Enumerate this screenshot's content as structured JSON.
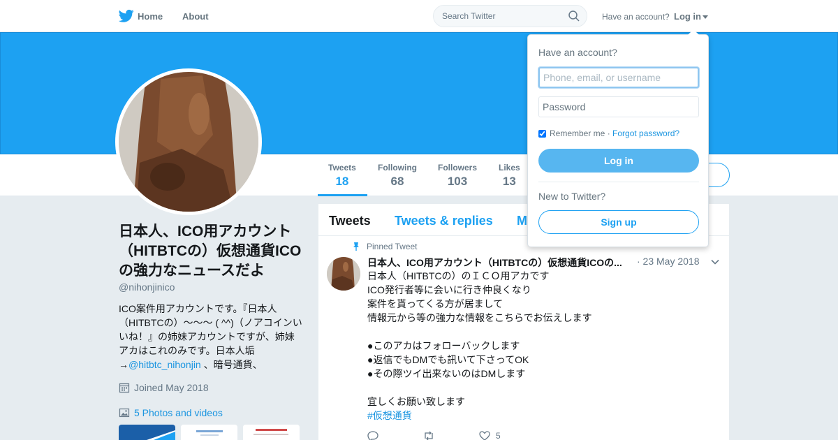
{
  "nav": {
    "home_label": "Home",
    "about_label": "About",
    "search_placeholder": "Search Twitter",
    "have_account": "Have an account?",
    "login_label": "Log in"
  },
  "profile": {
    "display_name": "日本人、ICO用アカウント（HITBTCの）仮想通貨ICOの強力なニュースだよ",
    "screen_name": "@nihonjinico",
    "bio": {
      "text": "ICO案件用アカウントです。『日本人（HITBTCの）～～～ ( ^^)（ノアコインいいね！』の姉妹アカウントですが、姉妹アカはこれのみです。日本人垢→",
      "link": "@hitbtc_nihonjin",
      "suffix": " 、暗号通貨、"
    },
    "joined": "Joined May 2018",
    "photos_link": "5 Photos and videos"
  },
  "stats": [
    {
      "label": "Tweets",
      "value": "18"
    },
    {
      "label": "Following",
      "value": "68"
    },
    {
      "label": "Followers",
      "value": "103"
    },
    {
      "label": "Likes",
      "value": "13"
    }
  ],
  "timeline": {
    "tabs": [
      "Tweets",
      "Tweets & replies",
      "M"
    ],
    "pinned_label": "Pinned Tweet",
    "tweet": {
      "fullname": "日本人、ICO用アカウント（HITBTCの）仮想通貨ICOの...",
      "date": "· 23 May 2018",
      "lines": [
        "日本人（HITBTCの）のＩＣＯ用アカです",
        "ICO発行者等に会いに行き仲良くなり",
        "案件を貰ってくる方が居まして",
        "情報元から等の強力な情報をこちらでお伝えします",
        "",
        "●このアカはフォローバックします",
        "●返信でもDMでも訊いて下さってOK",
        "●その際ツイ出来ないのはDMします",
        "",
        "宜しくお願い致します"
      ],
      "hashtag": "#仮想通貨",
      "like_count": "5"
    }
  },
  "login_dropdown": {
    "title": "Have an account?",
    "username_placeholder": "Phone, email, or username",
    "password_placeholder": "Password",
    "remember_label": "Remember me",
    "separator": " · ",
    "forgot_label": "Forgot password?",
    "login_button": "Log in",
    "new_label": "New to Twitter?",
    "signup_button": "Sign up"
  },
  "colors": {
    "brand_blue": "#1da1f2",
    "link_blue": "#1b95e0",
    "text_gray": "#657786",
    "background": "#e6ecf0"
  },
  "icons": [
    "twitter-bird-icon",
    "search-icon",
    "caret-down-icon",
    "calendar-icon",
    "photo-icon",
    "pin-icon",
    "chevron-down-icon",
    "reply-icon",
    "retweet-icon",
    "like-icon"
  ]
}
